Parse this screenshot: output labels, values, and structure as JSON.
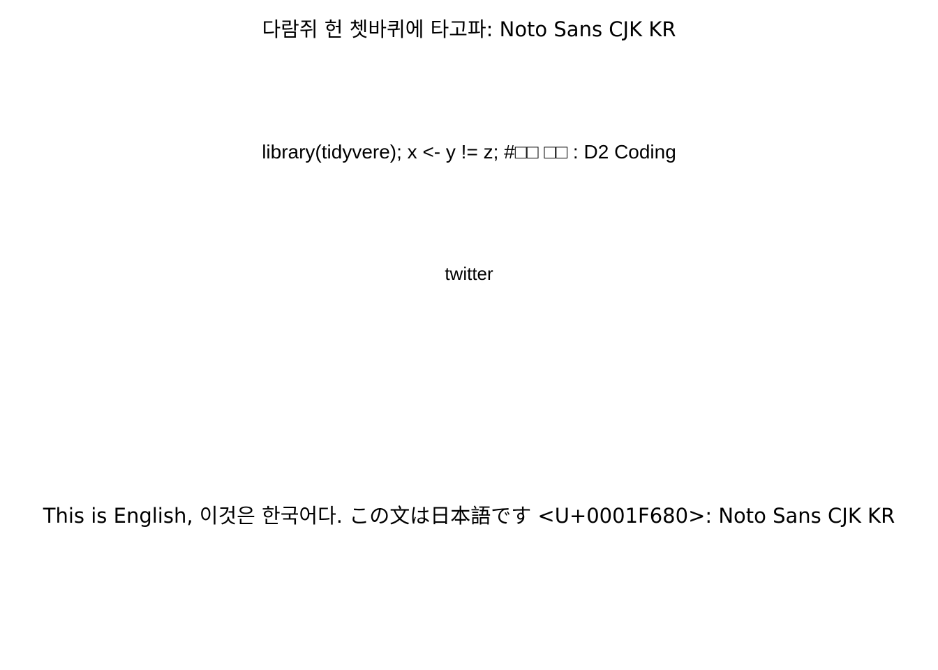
{
  "lines": {
    "hangul_sample": "다람쥐 헌 쳇바퀴에 타고파: Noto Sans CJK KR",
    "code_sample": "library(tidyvere); x <- y != z; #□□ □□ : D2 Coding",
    "twitter_sample": "twitter",
    "multilingual_sample": "This is English, 이것은 한국어다. この文は日本語です <U+0001F680>: Noto Sans CJK KR"
  }
}
